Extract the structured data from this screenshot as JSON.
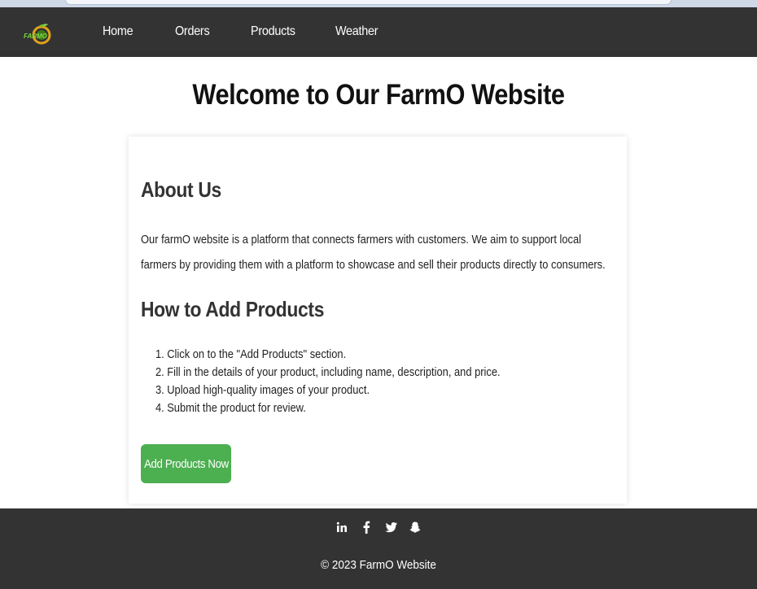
{
  "nav": {
    "logo_text": "FARMO",
    "links": [
      "Home",
      "Orders",
      "Products",
      "Weather"
    ]
  },
  "page": {
    "title": "Welcome to Our FarmO Website"
  },
  "about": {
    "heading": "About Us",
    "text": "Our farmO website is a platform that connects farmers with customers. We aim to support local farmers by providing them with a platform to showcase and sell their products directly to consumers."
  },
  "howto": {
    "heading": "How to Add Products",
    "steps": [
      "Click on to the \"Add Products\" section.",
      "Fill in the details of your product, including name, description, and price.",
      "Upload high-quality images of your product.",
      "Submit the product for review."
    ],
    "button_label": "Add Products Now"
  },
  "footer": {
    "social_icons": [
      "linkedin-icon",
      "facebook-icon",
      "twitter-icon",
      "snapchat-icon"
    ],
    "copyright": "© 2023 FarmO Website"
  },
  "colors": {
    "nav_bg": "#333333",
    "button_bg": "#4caf50",
    "footer_bg": "#333333"
  }
}
